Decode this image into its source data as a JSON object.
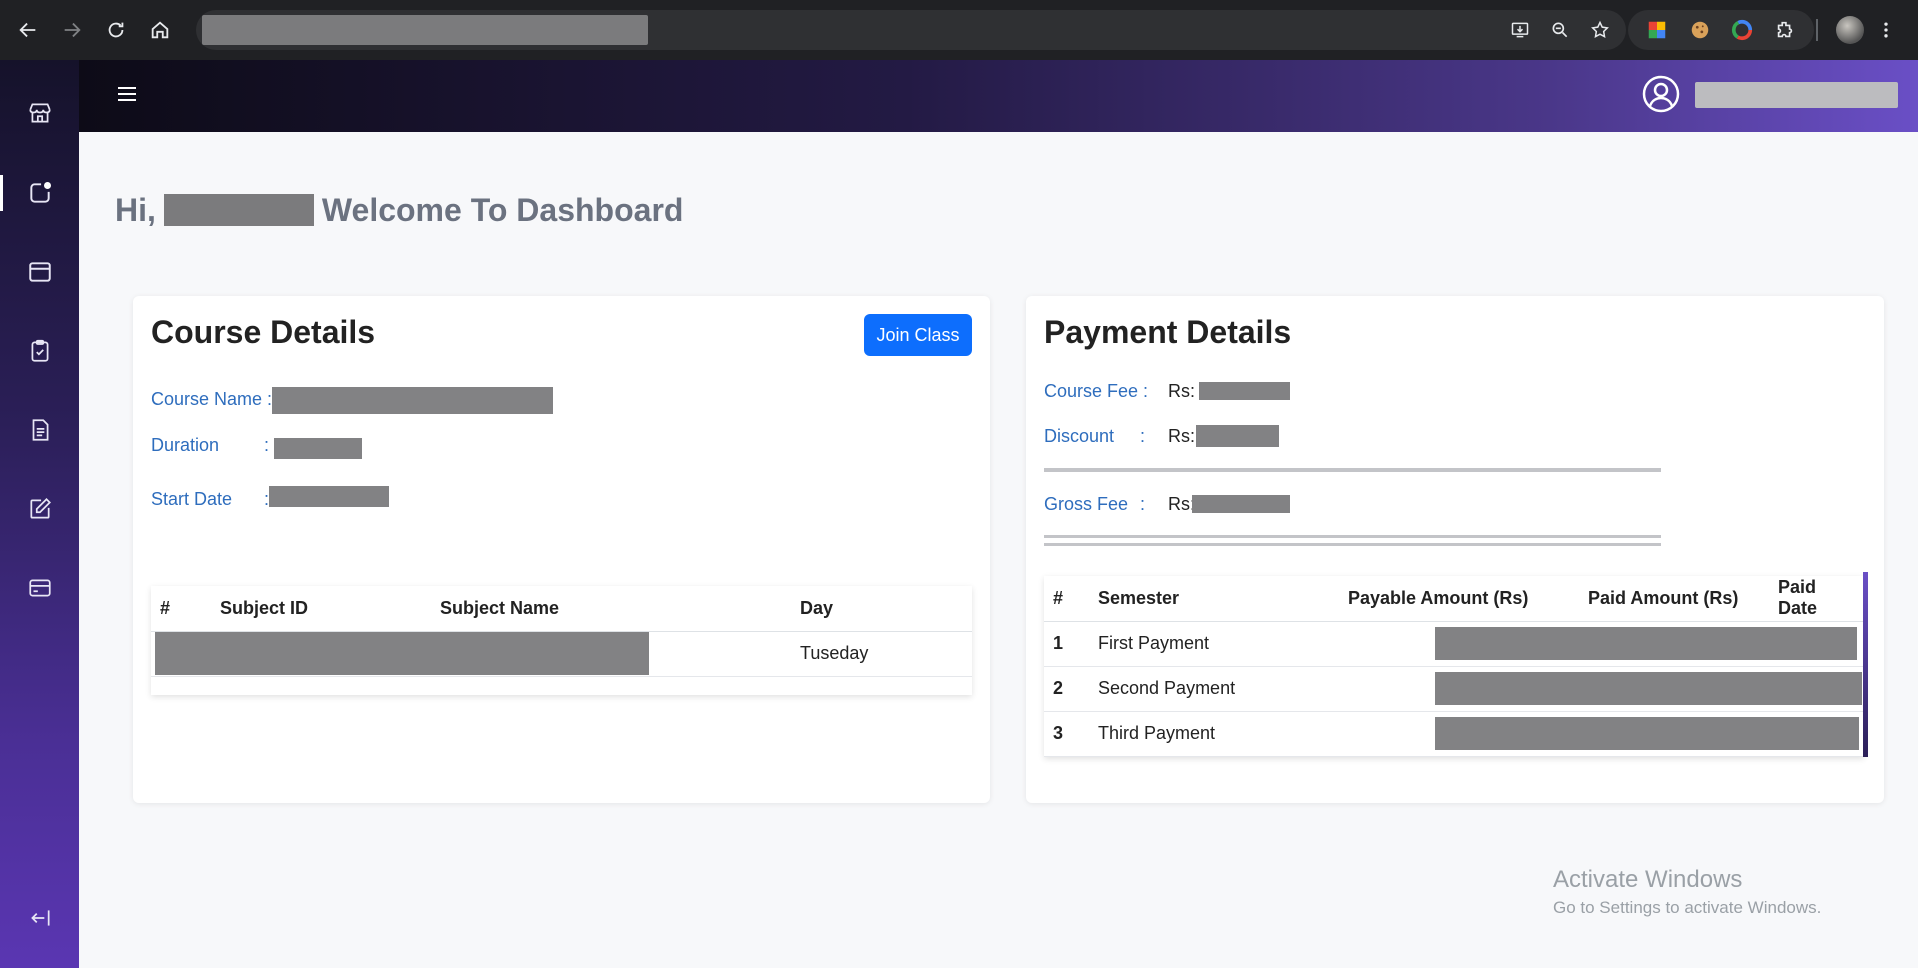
{
  "browser": {
    "url": "",
    "icons": [
      "back-icon",
      "forward-icon",
      "reload-icon",
      "home-icon",
      "install-icon",
      "zoom-icon",
      "bookmark-star-icon",
      "extensions-icon",
      "menu-icon"
    ]
  },
  "sidebar": {
    "items": [
      {
        "name": "store-icon"
      },
      {
        "name": "notification-icon",
        "active": true
      },
      {
        "name": "calendar-icon"
      },
      {
        "name": "clipboard-check-icon"
      },
      {
        "name": "document-icon"
      },
      {
        "name": "edit-icon"
      },
      {
        "name": "payment-card-icon"
      },
      {
        "name": "logout-icon"
      }
    ]
  },
  "header": {
    "user_name": ""
  },
  "welcome": {
    "prefix": "Hi,",
    "suffix": "Welcome To Dashboard"
  },
  "course": {
    "title": "Course Details",
    "join_label": "Join Class",
    "course_name_label": "Course Name :",
    "duration_label": "Duration",
    "start_date_label": "Start Date",
    "colon": ":",
    "table": {
      "headers": [
        "#",
        "Subject ID",
        "Subject Name",
        "Day"
      ],
      "rows": [
        {
          "day": "Tuseday"
        }
      ]
    }
  },
  "payment": {
    "title": "Payment Details",
    "course_fee_label": "Course Fee :",
    "discount_label": "Discount",
    "gross_fee_label": "Gross Fee",
    "colon": ":",
    "currency": "Rs:",
    "table": {
      "headers": [
        "#",
        "Semester",
        "Payable Amount (Rs)",
        "Paid Amount (Rs)",
        "Paid Date"
      ],
      "rows": [
        {
          "num": "1",
          "semester": "First Payment"
        },
        {
          "num": "2",
          "semester": "Second Payment"
        },
        {
          "num": "3",
          "semester": "Third Payment"
        }
      ]
    }
  },
  "watermark": {
    "line1": "Activate Windows",
    "line2": "Go to Settings to activate Windows."
  },
  "colors": {
    "accent": "#0d6efd",
    "label_blue": "#2e6dbd",
    "sidebar_top": "#15122a",
    "sidebar_bottom": "#5a36b2"
  }
}
